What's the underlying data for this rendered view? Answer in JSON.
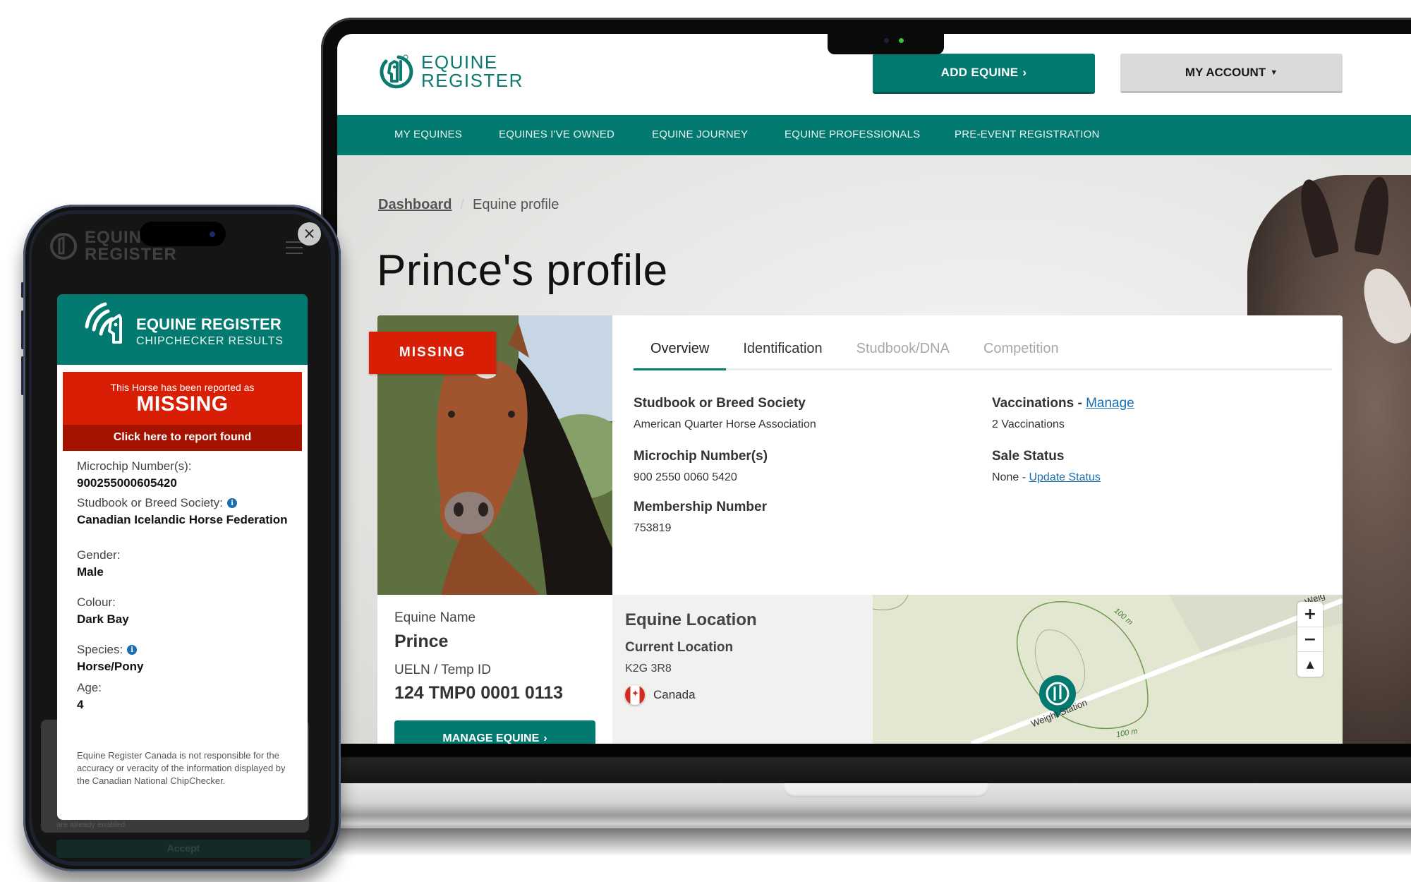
{
  "colors": {
    "brand_teal": "#027a70",
    "alert_red": "#d81e05",
    "alert_dark_red": "#a51200",
    "link_blue": "#1a6fb0"
  },
  "laptop": {
    "header": {
      "logo_line1": "EQUINE",
      "logo_line2": "REGISTER",
      "logo_icon": "equine-register-horse-head-icon",
      "add_equine_label": "ADD EQUINE",
      "add_equine_icon": "chevron-right-icon",
      "my_account_label": "MY ACCOUNT",
      "my_account_icon": "caret-down-icon"
    },
    "nav": [
      {
        "label": "MY EQUINES"
      },
      {
        "label": "EQUINES I'VE OWNED"
      },
      {
        "label": "EQUINE JOURNEY"
      },
      {
        "label": "EQUINE PROFESSIONALS"
      },
      {
        "label": "PRE-EVENT REGISTRATION"
      }
    ],
    "breadcrumb": {
      "home": "Dashboard",
      "separator": "/",
      "current": "Equine profile"
    },
    "page_title": "Prince's profile",
    "status_badge": "MISSING",
    "tabs": [
      {
        "label": "Overview",
        "state": "active"
      },
      {
        "label": "Identification",
        "state": "enabled"
      },
      {
        "label": "Studbook/DNA",
        "state": "disabled"
      },
      {
        "label": "Competition",
        "state": "disabled"
      }
    ],
    "overview": {
      "studbook": {
        "label": "Studbook or Breed Society",
        "value": "American Quarter Horse Association"
      },
      "microchip": {
        "label": "Microchip Number(s)",
        "value": "900 2550 0060 5420"
      },
      "membership": {
        "label": "Membership Number",
        "value": "753819"
      },
      "vaccinations": {
        "label": "Vaccinations",
        "separator": " - ",
        "link": "Manage",
        "value": "2 Vaccinations"
      },
      "sale_status": {
        "label": "Sale Status",
        "value": "None",
        "separator": " - ",
        "link": "Update Status"
      }
    },
    "equine": {
      "name_label": "Equine Name",
      "name": "Prince",
      "ueln_label": "UELN / Temp ID",
      "ueln": "124 TMP0 0001 0113",
      "manage_label": "MANAGE EQUINE",
      "manage_icon": "chevron-right-icon"
    },
    "location": {
      "title": "Equine Location",
      "current_label": "Current Location",
      "postal_code": "K2G 3R8",
      "country": "Canada",
      "country_flag_icon": "canada-flag-icon"
    },
    "map": {
      "road_label": "Weight Station",
      "road_label_edge": "Weig",
      "contour_label_top": "100 m",
      "contour_label_bottom": "100 m",
      "zoom_in": "+",
      "zoom_out": "−",
      "compass": "▲"
    }
  },
  "phone": {
    "background_logo_line1": "EQUINE",
    "background_logo_line2": "REGISTER",
    "close_icon": "×",
    "modal": {
      "title": "EQUINE REGISTER",
      "subtitle": "CHIPCHECKER RESULTS",
      "alert_line": "This Horse has been reported as",
      "alert_status": "MISSING",
      "alert_cta": "Click here to report found",
      "fields": [
        {
          "label": "Microchip Number(s):",
          "value": "900255000605420",
          "info": false
        },
        {
          "label": "Studbook or Breed Society:",
          "value": "Canadian Icelandic Horse Federation",
          "info": true
        },
        {
          "label": "Gender:",
          "value": "Male",
          "info": false
        },
        {
          "label": "Colour:",
          "value": "Dark Bay",
          "info": false
        },
        {
          "label": "Species:",
          "value": "Horse/Pony",
          "info": true
        },
        {
          "label": "Age:",
          "value": "4",
          "info": false
        }
      ],
      "disclaimer": "Equine Register Canada is not responsible for the accuracy or veracity of the information displayed by the Canadian National ChipChecker."
    },
    "behind": {
      "cookie_text": "are already enabled.",
      "accept_label": "Accept"
    }
  }
}
